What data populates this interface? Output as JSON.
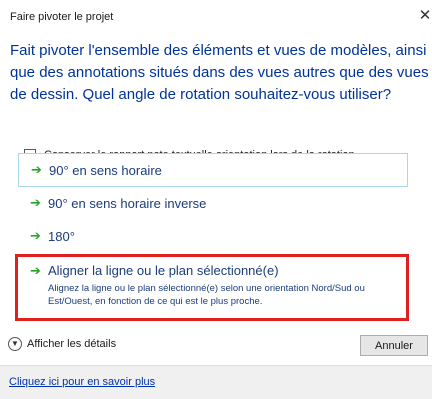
{
  "window": {
    "title": "Faire pivoter le projet",
    "close_glyph": "✕"
  },
  "instruction": "Fait pivoter l'ensemble des éléments et vues de modèles, ainsi que des annotations situés dans des vues autres que des vues de dessin. Quel angle de rotation souhaitez-vous utiliser?",
  "checkbox": {
    "label": "Conserver le rapport note textuelle orientation lors de la rotation",
    "checked": false
  },
  "commands": [
    {
      "label": "90° en sens horaire",
      "icon": "green-arrow-icon"
    },
    {
      "label": "90° en sens horaire inverse",
      "icon": "green-arrow-icon"
    },
    {
      "label": "180°",
      "icon": "green-arrow-icon"
    },
    {
      "label": "Aligner la ligne ou le plan sélectionné(e)",
      "note": "Alignez la ligne ou le plan sélectionné(e) selon une orientation Nord/Sud ou Est/Ouest, en fonction de ce qui est le plus proche.",
      "icon": "green-arrow-icon",
      "highlight_color": "#e02020"
    }
  ],
  "details": {
    "label": "Afficher les détails",
    "icon": "chevron-down-icon"
  },
  "cancel_label": "Annuler",
  "footer": {
    "link": "Cliquez ici pour en savoir plus"
  },
  "colors": {
    "instruction": "#003399",
    "arrow": "#26a626",
    "highlight": "#e02020"
  }
}
